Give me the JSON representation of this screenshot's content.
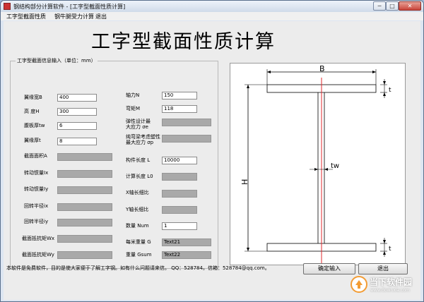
{
  "window": {
    "title": "钢结构部分计算软件 - [工字型截面性质计算]",
    "minimize": "─",
    "maximize": "□",
    "close": "✕"
  },
  "menu": [
    "工字型截面性质",
    "钢牛腿受力计算",
    "退出"
  ],
  "heading": "工字型截面性质计算",
  "group_title": "工字型截面信息输入（单位：mm）",
  "left_fields": [
    {
      "label": "翼缘宽B",
      "value": "400"
    },
    {
      "label": "高  度H",
      "value": "300"
    },
    {
      "label": "腹板厚tw",
      "value": "6"
    },
    {
      "label": "翼缘厚t",
      "value": "8"
    }
  ],
  "left_results": [
    {
      "label": "截面面积A",
      "value": ""
    },
    {
      "label": "转动惯量Ix",
      "value": ""
    },
    {
      "label": "转动惯量Iy",
      "value": ""
    },
    {
      "label": "回转半径ix",
      "value": ""
    },
    {
      "label": "回转半径iy",
      "value": ""
    },
    {
      "label": "截面抵抗矩Wx",
      "value": ""
    },
    {
      "label": "截面抵抗矩Wy",
      "value": ""
    }
  ],
  "right_fields": {
    "axial": {
      "label": "轴力N",
      "value": "150"
    },
    "moment": {
      "label": "弯矩M",
      "value": "118"
    },
    "strength": {
      "label1": "弹性设计最",
      "label2": "大应力 σe",
      "value": ""
    },
    "plastic": {
      "label1": "纯弯梁考虑塑性",
      "label2": "最大应力 σp",
      "value": ""
    },
    "length": {
      "label": "构件长度 L",
      "value": "10000"
    },
    "calc_length": {
      "label": "计算长度 L0",
      "value": ""
    },
    "x_slender": {
      "label": "X轴长细比",
      "value": ""
    },
    "y_slender": {
      "label": "Y轴长细比",
      "value": ""
    },
    "count": {
      "label": "数量 Num",
      "value": "1"
    },
    "unit_weight": {
      "label": "每米重量 G",
      "value": "Text21"
    },
    "total_weight": {
      "label": "重量 Gsum",
      "value": "Text22"
    }
  },
  "drawing_labels": {
    "b": "B",
    "h": "H",
    "tw": "tw",
    "t_top": "t",
    "t_bottom": "t"
  },
  "footer_text": "本软件是免费软件，目的是使大家便于了解工字钢。如有什么问题请来信。 QQ：528784。信箱：528784@qq.com。",
  "buttons": {
    "confirm": "确定输入",
    "exit": "退出"
  },
  "watermark": {
    "line1": "当下软件园",
    "line2": "www.downxia.com"
  },
  "colors": {
    "accent_line": "#e0282e",
    "readonly": "#a9a9a9"
  }
}
